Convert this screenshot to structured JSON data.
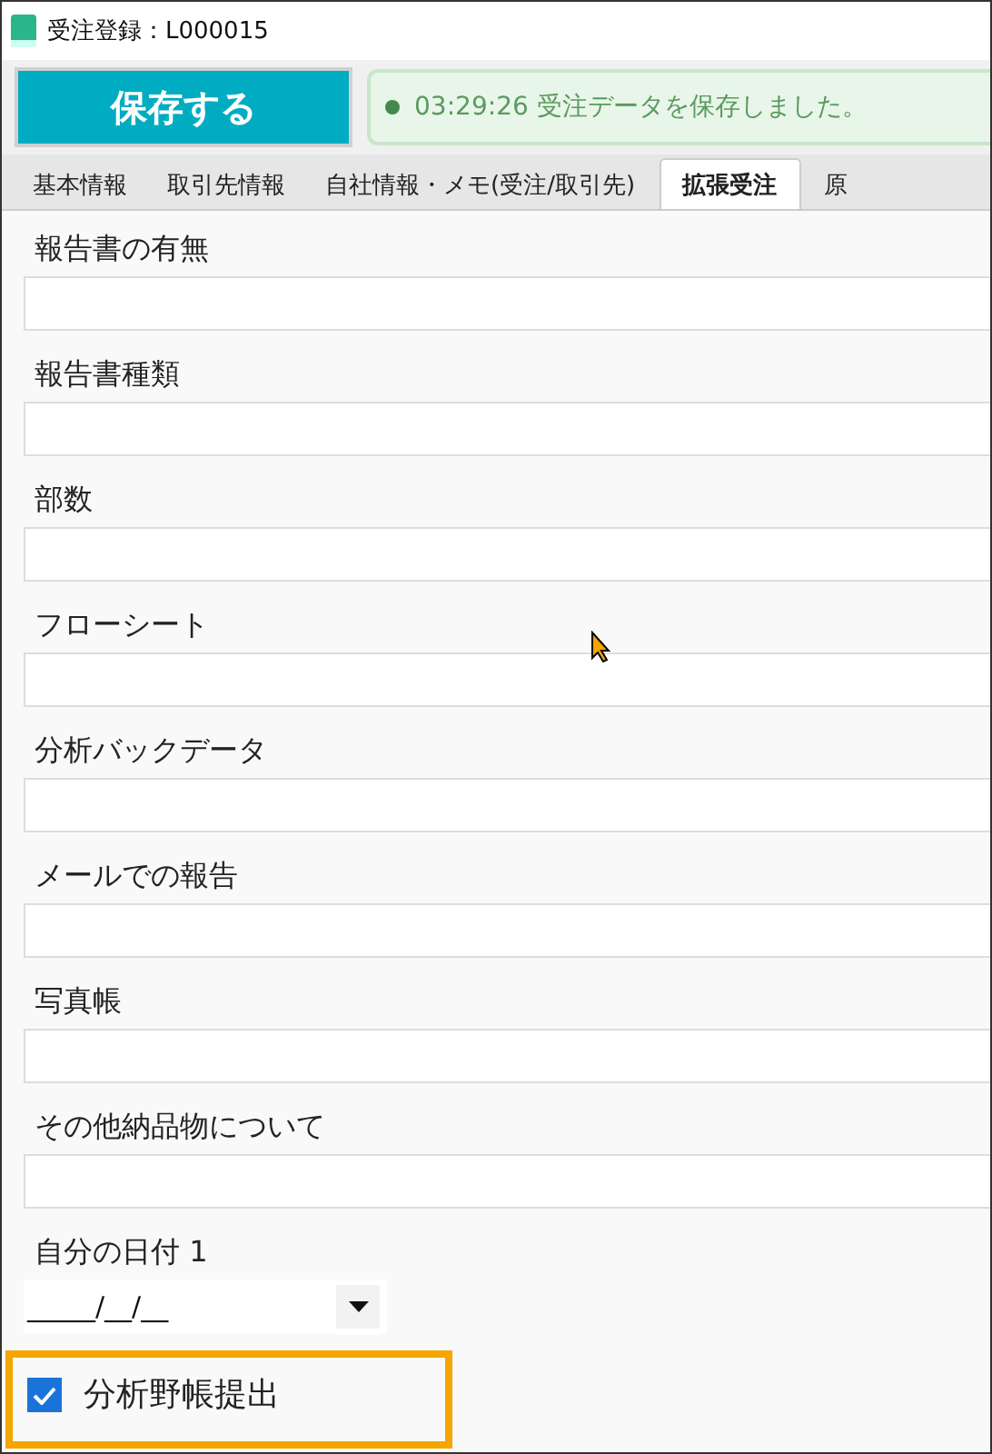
{
  "window": {
    "title": "受注登録：L000015"
  },
  "toolbar": {
    "save_button": "保存する",
    "status": {
      "time": "03:29:26",
      "message": "受注データを保存しました。"
    }
  },
  "tabs": [
    {
      "label": "基本情報",
      "selected": false
    },
    {
      "label": "取引先情報",
      "selected": false
    },
    {
      "label": "自社情報・メモ(受注/取引先)",
      "selected": false
    },
    {
      "label": "拡張受注",
      "selected": true
    },
    {
      "label": "原",
      "selected": false
    }
  ],
  "fields": [
    {
      "label": "報告書の有無",
      "kind": "text"
    },
    {
      "label": "報告書種類",
      "kind": "text"
    },
    {
      "label": "部数",
      "kind": "text"
    },
    {
      "label": "フローシート",
      "kind": "text"
    },
    {
      "label": "分析バックデータ",
      "kind": "text"
    },
    {
      "label": "メールでの報告",
      "kind": "text"
    },
    {
      "label": "写真帳",
      "kind": "text"
    },
    {
      "label": "その他納品物について",
      "kind": "text"
    },
    {
      "label": "自分の日付 1",
      "kind": "date",
      "value": "_____/__/__"
    }
  ],
  "checkbox": {
    "label": "分析野帳提出",
    "checked": true
  }
}
